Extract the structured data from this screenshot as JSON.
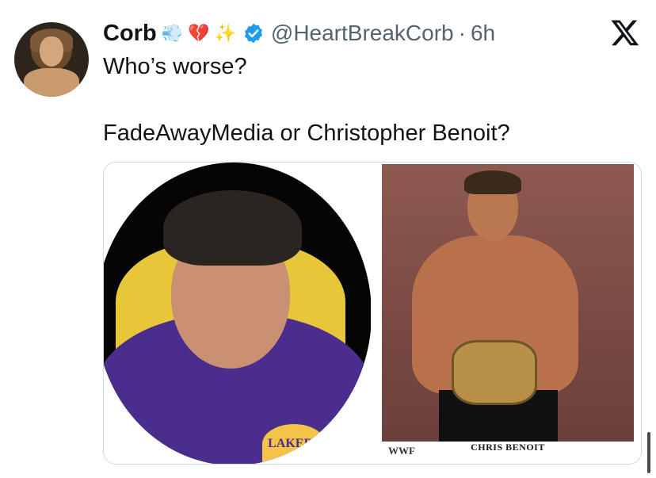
{
  "tweet": {
    "author_name": "Corb",
    "emojis": [
      "💨",
      "💔",
      "✨"
    ],
    "handle": "@HeartBreakCorb",
    "separator": "·",
    "time": "6h",
    "text_line1": "Who’s worse?",
    "text_line2": "FadeAwayMedia or Christopher Benoit?",
    "verified_color": "#1d9bf0"
  },
  "media": {
    "left_image_jersey_text": "LAKERS",
    "right_image_caption": "CHRIS BENOIT",
    "right_image_logo": "WWF"
  },
  "icons": {
    "close_brand": "x-logo-icon",
    "verified": "verified-badge-icon"
  }
}
